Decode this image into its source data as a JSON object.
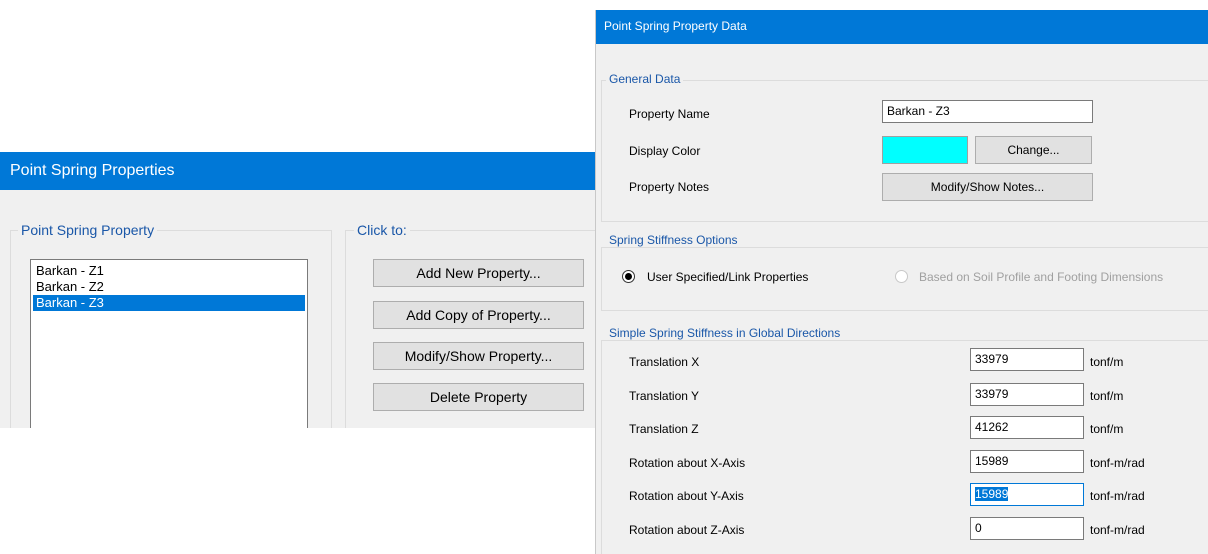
{
  "props_dialog": {
    "title": "Point Spring Properties",
    "group_label": "Point Spring Property",
    "items": [
      {
        "label": "Barkan - Z1"
      },
      {
        "label": "Barkan - Z2"
      },
      {
        "label": "Barkan - Z3"
      }
    ],
    "selected_index": 2,
    "click_group_label": "Click to:",
    "buttons": {
      "add_new": "Add New Property...",
      "add_copy": "Add Copy of Property...",
      "modify_show": "Modify/Show Property...",
      "delete": "Delete Property"
    }
  },
  "data_dialog": {
    "title": "Point Spring Property Data",
    "general": {
      "group_label": "General Data",
      "property_name_label": "Property Name",
      "property_name_value": "Barkan - Z3",
      "display_color_label": "Display Color",
      "display_color": "#00ffff",
      "change_button": "Change...",
      "notes_label": "Property Notes",
      "notes_button": "Modify/Show Notes..."
    },
    "options": {
      "group_label": "Spring Stiffness Options",
      "user_specified": "User Specified/Link Properties",
      "soil_profile": "Based on Soil Profile and Footing Dimensions",
      "selected": "user_specified"
    },
    "stiffness": {
      "group_label": "Simple Spring Stiffness in Global Directions",
      "rows": [
        {
          "label": "Translation  X",
          "value": "33979",
          "unit": "tonf/m"
        },
        {
          "label": "Translation  Y",
          "value": "33979",
          "unit": "tonf/m"
        },
        {
          "label": "Translation  Z",
          "value": "41262",
          "unit": "tonf/m"
        },
        {
          "label": "Rotation about  X-Axis",
          "value": "15989",
          "unit": "tonf-m/rad"
        },
        {
          "label": "Rotation about  Y-Axis",
          "value": "15989",
          "unit": "tonf-m/rad"
        },
        {
          "label": "Rotation about  Z-Axis",
          "value": "0",
          "unit": "tonf-m/rad"
        }
      ]
    }
  },
  "colors": {
    "accent": "#0078d7",
    "group_caption": "#1a57a8"
  }
}
